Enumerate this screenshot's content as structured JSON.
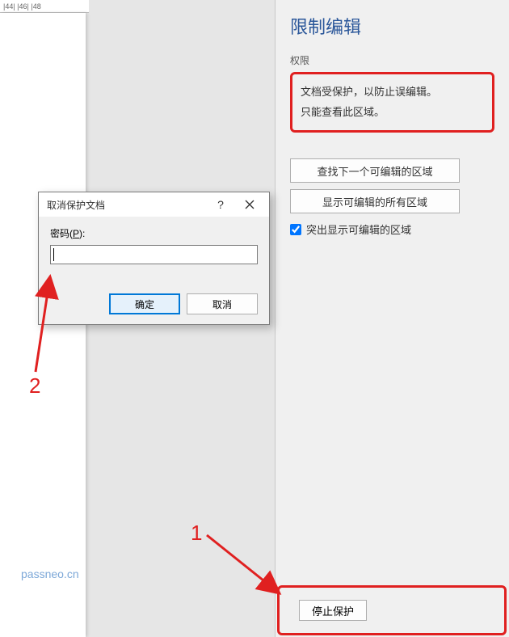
{
  "ruler": {
    "marks": [
      "|44|  |46|  |48"
    ]
  },
  "panel": {
    "title": "限制编辑",
    "permissions_label": "权限",
    "info_line1": "文档受保护，以防止误编辑。",
    "info_line2": "只能查看此区域。",
    "btn_find_next": "查找下一个可编辑的区域",
    "btn_show_all": "显示可编辑的所有区域",
    "checkbox_highlight": "突出显示可编辑的区域",
    "checkbox_checked": true,
    "btn_stop": "停止保护"
  },
  "dialog": {
    "title": "取消保护文档",
    "help": "?",
    "password_label_prefix": "密码(",
    "password_label_key": "P",
    "password_label_suffix": "):",
    "password_value": "",
    "ok": "确定",
    "cancel": "取消"
  },
  "annotations": {
    "num1": "1",
    "num2": "2",
    "watermark": "passneo.cn",
    "arrow_color": "#e02020"
  }
}
